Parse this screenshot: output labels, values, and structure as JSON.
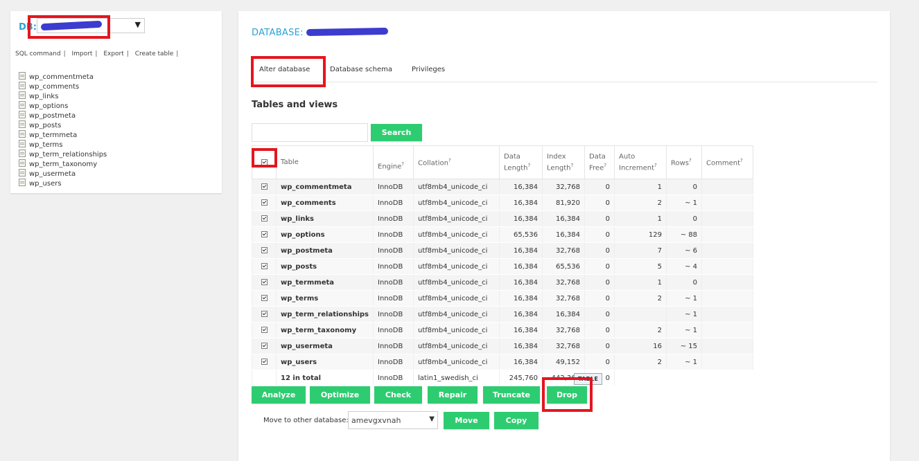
{
  "sidebar": {
    "db_label": "DB:",
    "links": [
      "SQL command",
      "Import",
      "Export",
      "Create table"
    ],
    "tables": [
      "wp_commentmeta",
      "wp_comments",
      "wp_links",
      "wp_options",
      "wp_postmeta",
      "wp_posts",
      "wp_termmeta",
      "wp_terms",
      "wp_term_relationships",
      "wp_term_taxonomy",
      "wp_usermeta",
      "wp_users"
    ]
  },
  "main": {
    "title": "DATABASE:",
    "tabs": [
      "Alter database",
      "Database schema",
      "Privileges"
    ],
    "section_title": "Tables and views",
    "search_button": "Search",
    "columns": [
      "Table",
      "Engine",
      "Collation",
      "Data Length",
      "Index Length",
      "Data Free",
      "Auto Increment",
      "Rows",
      "Comment"
    ],
    "rows": [
      {
        "name": "wp_commentmeta",
        "engine": "InnoDB",
        "collation": "utf8mb4_unicode_ci",
        "data_length": "16,384",
        "index_length": "32,768",
        "data_free": "0",
        "auto_increment": "1",
        "rows": "0"
      },
      {
        "name": "wp_comments",
        "engine": "InnoDB",
        "collation": "utf8mb4_unicode_ci",
        "data_length": "16,384",
        "index_length": "81,920",
        "data_free": "0",
        "auto_increment": "2",
        "rows": "~ 1"
      },
      {
        "name": "wp_links",
        "engine": "InnoDB",
        "collation": "utf8mb4_unicode_ci",
        "data_length": "16,384",
        "index_length": "16,384",
        "data_free": "0",
        "auto_increment": "1",
        "rows": "0"
      },
      {
        "name": "wp_options",
        "engine": "InnoDB",
        "collation": "utf8mb4_unicode_ci",
        "data_length": "65,536",
        "index_length": "16,384",
        "data_free": "0",
        "auto_increment": "129",
        "rows": "~ 88"
      },
      {
        "name": "wp_postmeta",
        "engine": "InnoDB",
        "collation": "utf8mb4_unicode_ci",
        "data_length": "16,384",
        "index_length": "32,768",
        "data_free": "0",
        "auto_increment": "7",
        "rows": "~ 6"
      },
      {
        "name": "wp_posts",
        "engine": "InnoDB",
        "collation": "utf8mb4_unicode_ci",
        "data_length": "16,384",
        "index_length": "65,536",
        "data_free": "0",
        "auto_increment": "5",
        "rows": "~ 4"
      },
      {
        "name": "wp_termmeta",
        "engine": "InnoDB",
        "collation": "utf8mb4_unicode_ci",
        "data_length": "16,384",
        "index_length": "32,768",
        "data_free": "0",
        "auto_increment": "1",
        "rows": "0"
      },
      {
        "name": "wp_terms",
        "engine": "InnoDB",
        "collation": "utf8mb4_unicode_ci",
        "data_length": "16,384",
        "index_length": "32,768",
        "data_free": "0",
        "auto_increment": "2",
        "rows": "~ 1"
      },
      {
        "name": "wp_term_relationships",
        "engine": "InnoDB",
        "collation": "utf8mb4_unicode_ci",
        "data_length": "16,384",
        "index_length": "16,384",
        "data_free": "0",
        "auto_increment": "",
        "rows": "~ 1"
      },
      {
        "name": "wp_term_taxonomy",
        "engine": "InnoDB",
        "collation": "utf8mb4_unicode_ci",
        "data_length": "16,384",
        "index_length": "32,768",
        "data_free": "0",
        "auto_increment": "2",
        "rows": "~ 1"
      },
      {
        "name": "wp_usermeta",
        "engine": "InnoDB",
        "collation": "utf8mb4_unicode_ci",
        "data_length": "16,384",
        "index_length": "32,768",
        "data_free": "0",
        "auto_increment": "16",
        "rows": "~ 15"
      },
      {
        "name": "wp_users",
        "engine": "InnoDB",
        "collation": "utf8mb4_unicode_ci",
        "data_length": "16,384",
        "index_length": "49,152",
        "data_free": "0",
        "auto_increment": "2",
        "rows": "~ 1"
      }
    ],
    "total": {
      "label": "12 in total",
      "engine": "InnoDB",
      "collation": "latin1_swedish_ci",
      "data_length": "245,760",
      "index_length": "442,368",
      "data_free": "0"
    },
    "actions": [
      "Analyze",
      "Optimize",
      "Check",
      "Repair",
      "Truncate",
      "Drop"
    ],
    "tooltip": "TABLE",
    "move_label": "Move to other database:",
    "move_select_value": "amevgxvnah",
    "move_button": "Move",
    "copy_button": "Copy"
  },
  "colors": {
    "accent": "#2aa1d6",
    "button": "#2ecc71",
    "highlight": "#e3161e",
    "redaction": "#3c3ccf"
  }
}
